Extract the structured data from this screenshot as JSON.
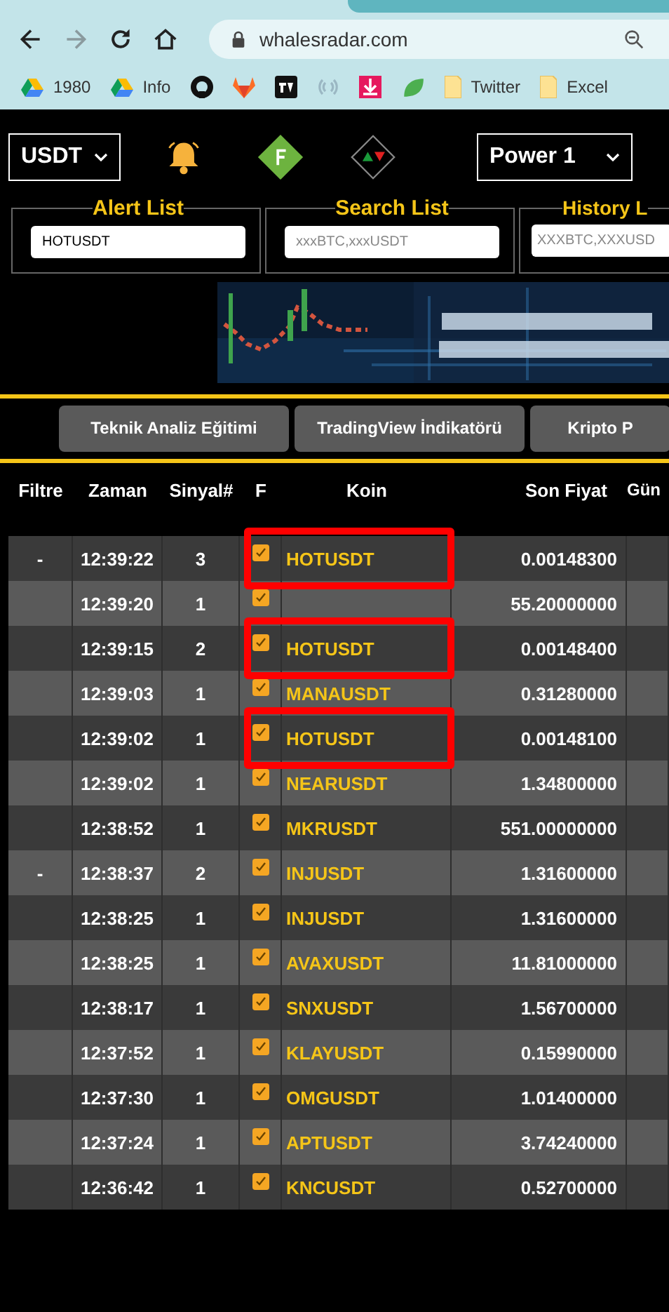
{
  "browser": {
    "url": "whalesradar.com",
    "bookmarks": [
      {
        "kind": "drive",
        "label": "1980"
      },
      {
        "kind": "drive",
        "label": "Info"
      },
      {
        "kind": "github"
      },
      {
        "kind": "gitlab"
      },
      {
        "kind": "tv"
      },
      {
        "kind": "signal"
      },
      {
        "kind": "download"
      },
      {
        "kind": "leaf"
      },
      {
        "kind": "folder",
        "label": "Twitter"
      },
      {
        "kind": "folder",
        "label": "Excel"
      }
    ]
  },
  "toolbar": {
    "currency": "USDT",
    "power": "Power 1"
  },
  "lists": [
    {
      "title": "Alert List",
      "value": "HOTUSDT"
    },
    {
      "title": "Search List",
      "placeholder": "xxxBTC,xxxUSDT"
    },
    {
      "title": "History L",
      "placeholder": "XXXBTC,XXXUSD"
    }
  ],
  "links": [
    "Teknik Analiz Eğitimi",
    "TradingView İndikatörü",
    "Kripto P"
  ],
  "table": {
    "columns": [
      "Filtre",
      "Zaman",
      "Sinyal#",
      "F",
      "Koin",
      "Son Fiyat",
      "Gün"
    ],
    "rows": [
      {
        "filter": "-",
        "time": "12:39:22",
        "signal": "3",
        "checked": true,
        "coin": "HOTUSDT",
        "price": "0.00148300",
        "highlighted": true
      },
      {
        "time": "12:39:20",
        "signal": "1",
        "checked": true,
        "price": "55.20000000",
        "highlighted": false
      },
      {
        "time": "12:39:15",
        "signal": "2",
        "checked": true,
        "coin": "HOTUSDT",
        "price": "0.00148400",
        "highlighted": true
      },
      {
        "time": "12:39:03",
        "signal": "1",
        "checked": true,
        "coin": "MANAUSDT",
        "price": "0.31280000",
        "highlighted": false
      },
      {
        "time": "12:39:02",
        "signal": "1",
        "checked": true,
        "coin": "HOTUSDT",
        "price": "0.00148100",
        "highlighted": true
      },
      {
        "time": "12:39:02",
        "signal": "1",
        "checked": true,
        "coin": "NEARUSDT",
        "price": "1.34800000",
        "highlighted": false
      },
      {
        "time": "12:38:52",
        "signal": "1",
        "checked": true,
        "coin": "MKRUSDT",
        "price": "551.00000000",
        "highlighted": false
      },
      {
        "filter": "-",
        "time": "12:38:37",
        "signal": "2",
        "checked": true,
        "coin": "INJUSDT",
        "price": "1.31600000",
        "highlighted": false
      },
      {
        "time": "12:38:25",
        "signal": "1",
        "checked": true,
        "coin": "INJUSDT",
        "price": "1.31600000",
        "highlighted": false
      },
      {
        "time": "12:38:25",
        "signal": "1",
        "checked": true,
        "coin": "AVAXUSDT",
        "price": "11.81000000",
        "highlighted": false
      },
      {
        "time": "12:38:17",
        "signal": "1",
        "checked": true,
        "coin": "SNXUSDT",
        "price": "1.56700000",
        "highlighted": false
      },
      {
        "time": "12:37:52",
        "signal": "1",
        "checked": true,
        "coin": "KLAYUSDT",
        "price": "0.15990000",
        "highlighted": false
      },
      {
        "time": "12:37:30",
        "signal": "1",
        "checked": true,
        "coin": "OMGUSDT",
        "price": "1.01400000",
        "highlighted": false
      },
      {
        "time": "12:37:24",
        "signal": "1",
        "checked": true,
        "coin": "APTUSDT",
        "price": "3.74240000",
        "highlighted": false
      },
      {
        "time": "12:36:42",
        "signal": "1",
        "checked": true,
        "coin": "KNCUSDT",
        "price": "0.52700000",
        "highlighted": false
      }
    ]
  }
}
